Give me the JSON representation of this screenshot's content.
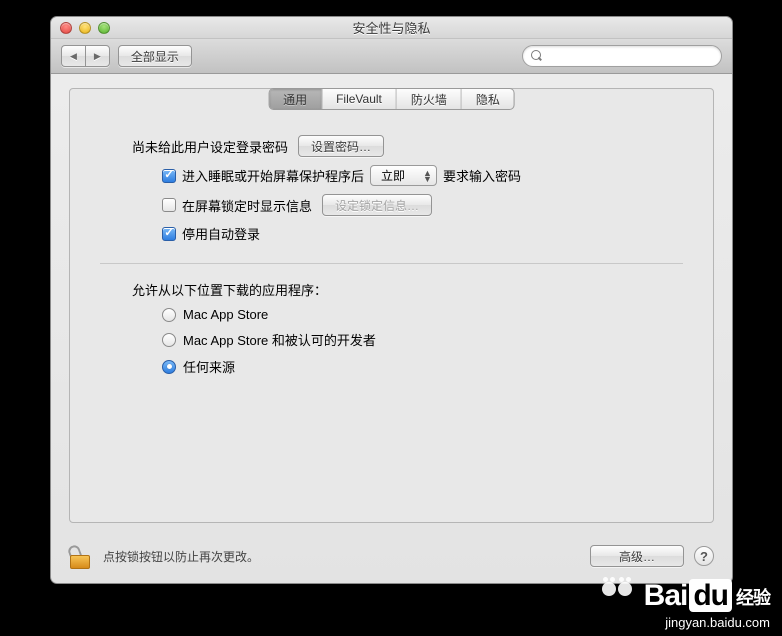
{
  "window": {
    "title": "安全性与隐私"
  },
  "toolbar": {
    "back_aria": "后退",
    "forward_aria": "前进",
    "show_all_label": "全部显示",
    "search_placeholder": ""
  },
  "tabs": [
    {
      "label": "通用",
      "selected": true
    },
    {
      "label": "FileVault",
      "selected": false
    },
    {
      "label": "防火墙",
      "selected": false
    },
    {
      "label": "隐私",
      "selected": false
    }
  ],
  "general": {
    "no_password_set_label": "尚未给此用户设定登录密码",
    "set_password_button": "设置密码…",
    "require_password_checkbox": {
      "checked": true,
      "label": "进入睡眠或开始屏幕保护程序后"
    },
    "require_password_delay": {
      "selected": "立即"
    },
    "require_password_suffix": "要求输入密码",
    "show_lock_message_checkbox": {
      "checked": false,
      "label": "在屏幕锁定时显示信息"
    },
    "set_lock_message_button": "设定锁定信息…",
    "disable_auto_login_checkbox": {
      "checked": true,
      "label": "停用自动登录"
    },
    "allow_apps_label": "允许从以下位置下载的应用程序：",
    "allow_apps_options": [
      {
        "label": "Mac App Store",
        "selected": false
      },
      {
        "label": "Mac App Store 和被认可的开发者",
        "selected": false
      },
      {
        "label": "任何来源",
        "selected": true
      }
    ]
  },
  "footer": {
    "lock_message": "点按锁按钮以防止再次更改。",
    "advanced_button": "高级…"
  },
  "watermark": {
    "brand_bai": "Bai",
    "brand_du": "du",
    "brand_suffix": "经验",
    "url": "jingyan.baidu.com"
  }
}
